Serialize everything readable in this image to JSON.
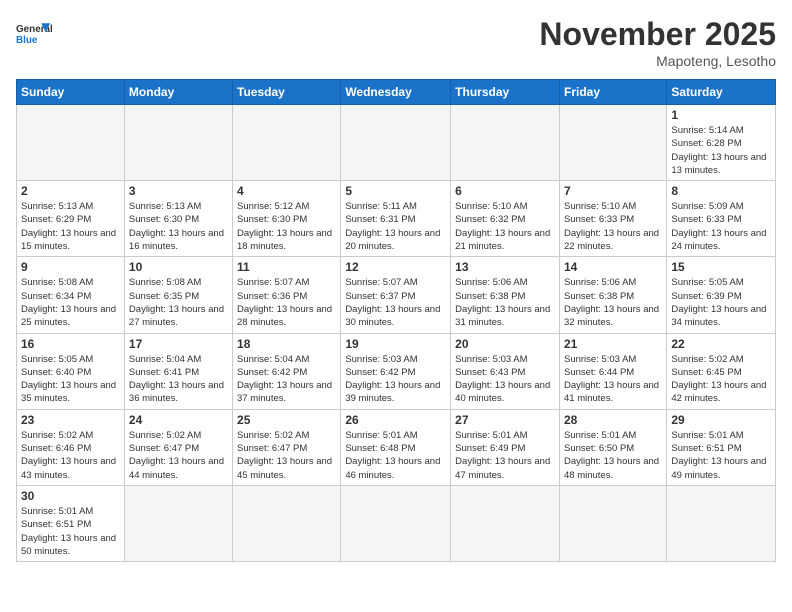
{
  "header": {
    "logo_general": "General",
    "logo_blue": "Blue",
    "month": "November 2025",
    "location": "Mapoteng, Lesotho"
  },
  "days_of_week": [
    "Sunday",
    "Monday",
    "Tuesday",
    "Wednesday",
    "Thursday",
    "Friday",
    "Saturday"
  ],
  "weeks": [
    [
      {
        "day": "",
        "info": ""
      },
      {
        "day": "",
        "info": ""
      },
      {
        "day": "",
        "info": ""
      },
      {
        "day": "",
        "info": ""
      },
      {
        "day": "",
        "info": ""
      },
      {
        "day": "",
        "info": ""
      },
      {
        "day": "1",
        "info": "Sunrise: 5:14 AM\nSunset: 6:28 PM\nDaylight: 13 hours and 13 minutes."
      }
    ],
    [
      {
        "day": "2",
        "info": "Sunrise: 5:13 AM\nSunset: 6:29 PM\nDaylight: 13 hours and 15 minutes."
      },
      {
        "day": "3",
        "info": "Sunrise: 5:13 AM\nSunset: 6:30 PM\nDaylight: 13 hours and 16 minutes."
      },
      {
        "day": "4",
        "info": "Sunrise: 5:12 AM\nSunset: 6:30 PM\nDaylight: 13 hours and 18 minutes."
      },
      {
        "day": "5",
        "info": "Sunrise: 5:11 AM\nSunset: 6:31 PM\nDaylight: 13 hours and 20 minutes."
      },
      {
        "day": "6",
        "info": "Sunrise: 5:10 AM\nSunset: 6:32 PM\nDaylight: 13 hours and 21 minutes."
      },
      {
        "day": "7",
        "info": "Sunrise: 5:10 AM\nSunset: 6:33 PM\nDaylight: 13 hours and 22 minutes."
      },
      {
        "day": "8",
        "info": "Sunrise: 5:09 AM\nSunset: 6:33 PM\nDaylight: 13 hours and 24 minutes."
      }
    ],
    [
      {
        "day": "9",
        "info": "Sunrise: 5:08 AM\nSunset: 6:34 PM\nDaylight: 13 hours and 25 minutes."
      },
      {
        "day": "10",
        "info": "Sunrise: 5:08 AM\nSunset: 6:35 PM\nDaylight: 13 hours and 27 minutes."
      },
      {
        "day": "11",
        "info": "Sunrise: 5:07 AM\nSunset: 6:36 PM\nDaylight: 13 hours and 28 minutes."
      },
      {
        "day": "12",
        "info": "Sunrise: 5:07 AM\nSunset: 6:37 PM\nDaylight: 13 hours and 30 minutes."
      },
      {
        "day": "13",
        "info": "Sunrise: 5:06 AM\nSunset: 6:38 PM\nDaylight: 13 hours and 31 minutes."
      },
      {
        "day": "14",
        "info": "Sunrise: 5:06 AM\nSunset: 6:38 PM\nDaylight: 13 hours and 32 minutes."
      },
      {
        "day": "15",
        "info": "Sunrise: 5:05 AM\nSunset: 6:39 PM\nDaylight: 13 hours and 34 minutes."
      }
    ],
    [
      {
        "day": "16",
        "info": "Sunrise: 5:05 AM\nSunset: 6:40 PM\nDaylight: 13 hours and 35 minutes."
      },
      {
        "day": "17",
        "info": "Sunrise: 5:04 AM\nSunset: 6:41 PM\nDaylight: 13 hours and 36 minutes."
      },
      {
        "day": "18",
        "info": "Sunrise: 5:04 AM\nSunset: 6:42 PM\nDaylight: 13 hours and 37 minutes."
      },
      {
        "day": "19",
        "info": "Sunrise: 5:03 AM\nSunset: 6:42 PM\nDaylight: 13 hours and 39 minutes."
      },
      {
        "day": "20",
        "info": "Sunrise: 5:03 AM\nSunset: 6:43 PM\nDaylight: 13 hours and 40 minutes."
      },
      {
        "day": "21",
        "info": "Sunrise: 5:03 AM\nSunset: 6:44 PM\nDaylight: 13 hours and 41 minutes."
      },
      {
        "day": "22",
        "info": "Sunrise: 5:02 AM\nSunset: 6:45 PM\nDaylight: 13 hours and 42 minutes."
      }
    ],
    [
      {
        "day": "23",
        "info": "Sunrise: 5:02 AM\nSunset: 6:46 PM\nDaylight: 13 hours and 43 minutes."
      },
      {
        "day": "24",
        "info": "Sunrise: 5:02 AM\nSunset: 6:47 PM\nDaylight: 13 hours and 44 minutes."
      },
      {
        "day": "25",
        "info": "Sunrise: 5:02 AM\nSunset: 6:47 PM\nDaylight: 13 hours and 45 minutes."
      },
      {
        "day": "26",
        "info": "Sunrise: 5:01 AM\nSunset: 6:48 PM\nDaylight: 13 hours and 46 minutes."
      },
      {
        "day": "27",
        "info": "Sunrise: 5:01 AM\nSunset: 6:49 PM\nDaylight: 13 hours and 47 minutes."
      },
      {
        "day": "28",
        "info": "Sunrise: 5:01 AM\nSunset: 6:50 PM\nDaylight: 13 hours and 48 minutes."
      },
      {
        "day": "29",
        "info": "Sunrise: 5:01 AM\nSunset: 6:51 PM\nDaylight: 13 hours and 49 minutes."
      }
    ],
    [
      {
        "day": "30",
        "info": "Sunrise: 5:01 AM\nSunset: 6:51 PM\nDaylight: 13 hours and 50 minutes."
      },
      {
        "day": "",
        "info": ""
      },
      {
        "day": "",
        "info": ""
      },
      {
        "day": "",
        "info": ""
      },
      {
        "day": "",
        "info": ""
      },
      {
        "day": "",
        "info": ""
      },
      {
        "day": "",
        "info": ""
      }
    ]
  ]
}
